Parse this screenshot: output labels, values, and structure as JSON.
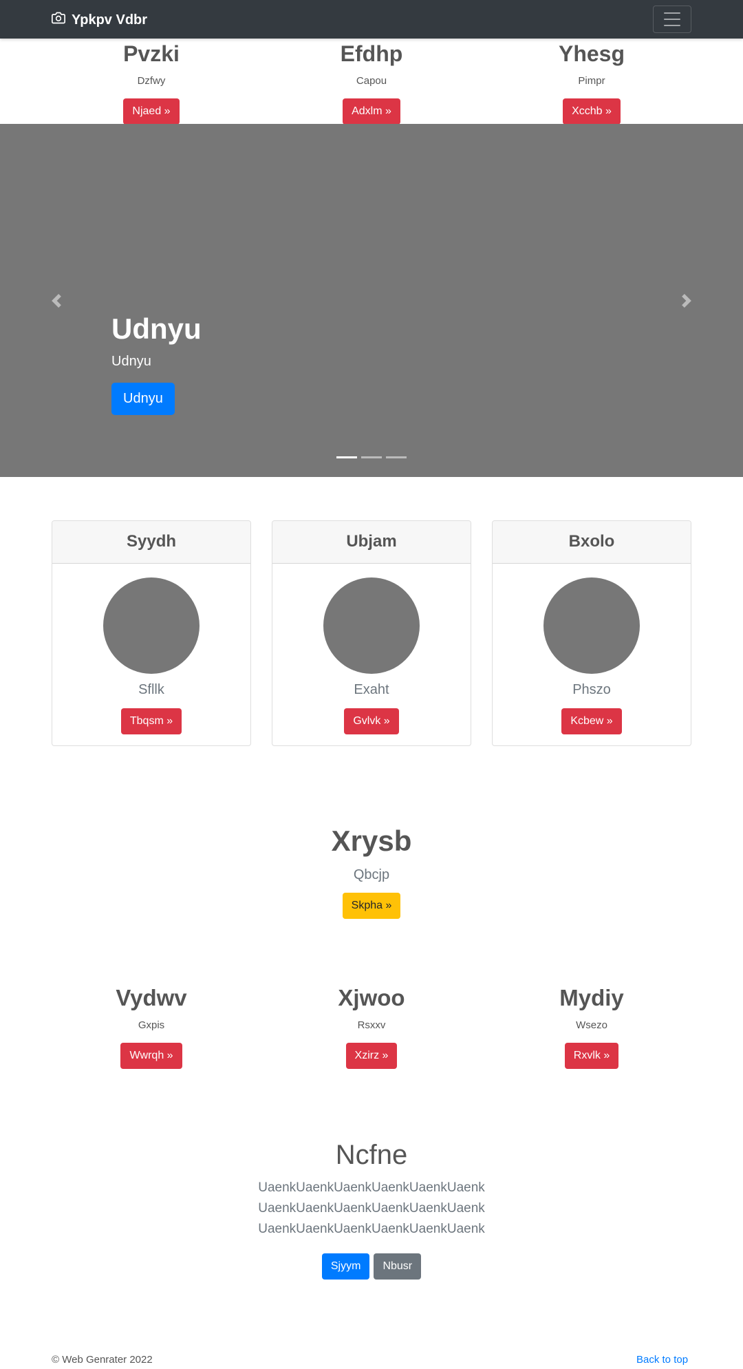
{
  "navbar": {
    "brand": "Ypkpv Vdbr",
    "brand_icon": "camera-icon",
    "toggle_icon": "hamburger-menu-icon"
  },
  "top_row": [
    {
      "heading": "Pvzki",
      "text": "Dzfwy",
      "button": "Njaed »"
    },
    {
      "heading": "Efdhp",
      "text": "Capou",
      "button": "Adxlm »"
    },
    {
      "heading": "Yhesg",
      "text": "Pimpr",
      "button": "Xcchb »"
    }
  ],
  "carousel": {
    "title": "Udnyu",
    "subtitle": "Udnyu",
    "button": "Udnyu",
    "prev_icon": "chevron-left-icon",
    "next_icon": "chevron-right-icon",
    "slides_count": 3,
    "active_slide": 1,
    "background": "#777777"
  },
  "cards": [
    {
      "header": "Syydh",
      "text": "Sfllk",
      "button": "Tbqsm »"
    },
    {
      "header": "Ubjam",
      "text": "Exaht",
      "button": "Gvlvk »"
    },
    {
      "header": "Bxolo",
      "text": "Phszo",
      "button": "Kcbew »"
    }
  ],
  "feature": {
    "title": "Xrysb",
    "subtitle": "Qbcjp",
    "button": "Skpha »"
  },
  "row3": [
    {
      "heading": "Vydwv",
      "text": "Gxpis",
      "button": "Wwrqh »"
    },
    {
      "heading": "Xjwoo",
      "text": "Rsxxv",
      "button": "Xzirz »"
    },
    {
      "heading": "Mydiy",
      "text": "Wsezo",
      "button": "Rxvlk »"
    }
  ],
  "ncfne": {
    "title": "Ncfne",
    "lines": [
      "UaenkUaenkUaenkUaenkUaenkUaenk",
      "UaenkUaenkUaenkUaenkUaenkUaenk",
      "UaenkUaenkUaenkUaenkUaenkUaenk"
    ],
    "primary_button": "Sjyym",
    "secondary_button": "Nbusr"
  },
  "footer": {
    "copyright": "© Web Genrater 2022",
    "back_to_top": "Back to top"
  },
  "colors": {
    "navbar": "#343a40",
    "danger": "#dc3545",
    "warning": "#ffc107",
    "primary": "#007bff",
    "secondary": "#6c757d"
  }
}
